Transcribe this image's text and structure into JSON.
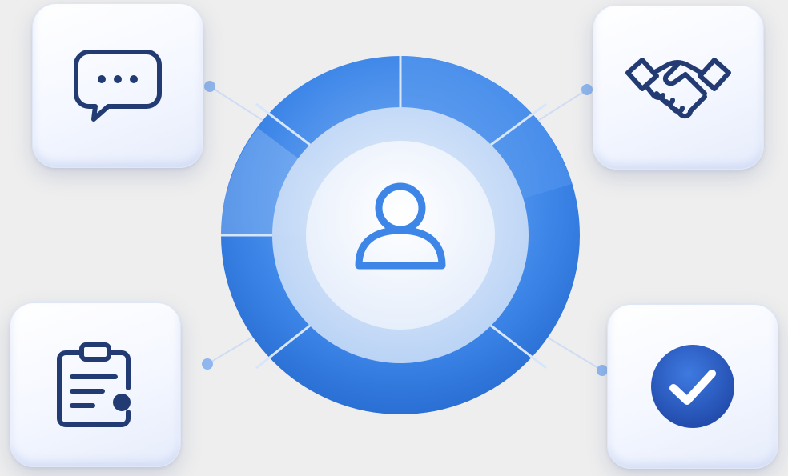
{
  "diagram": {
    "center": {
      "icon": "user-icon"
    },
    "nodes": [
      {
        "icon": "chat-bubble-icon",
        "position": "top-left"
      },
      {
        "icon": "handshake-icon",
        "position": "top-right"
      },
      {
        "icon": "clipboard-document-icon",
        "position": "bottom-left"
      },
      {
        "icon": "check-circle-icon",
        "position": "bottom-right"
      }
    ],
    "colors": {
      "background": "#eeeeee",
      "accent": "#3d86e8",
      "icon_stroke": "#233b73",
      "check_fill": "#2457c5"
    }
  }
}
